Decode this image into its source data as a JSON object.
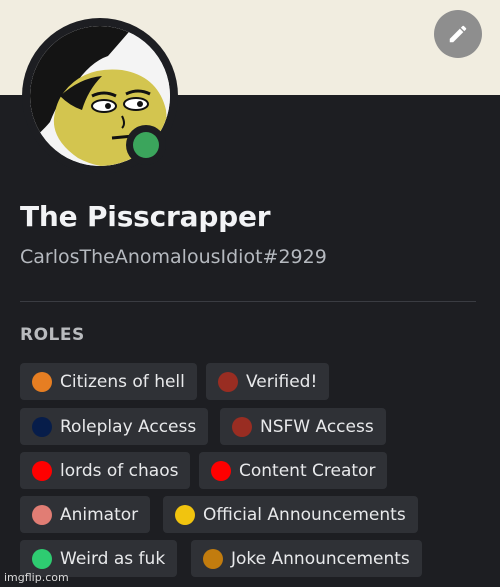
{
  "profile": {
    "display_name": "The Pisscrapper",
    "username_tag": "CarlosTheAnomalousIdiot#2929",
    "status": "online",
    "status_color": "#3ba55c"
  },
  "banner": {
    "color": "#f1ede0"
  },
  "edit_button": {
    "icon": "pencil-icon"
  },
  "roles": {
    "heading": "ROLES",
    "items": [
      {
        "label": "Citizens of hell",
        "color": "#e67e22"
      },
      {
        "label": "Verified!",
        "color": "#992d22"
      },
      {
        "label": "Roleplay Access",
        "color": "#071d4a"
      },
      {
        "label": "NSFW Access",
        "color": "#992d22"
      },
      {
        "label": "lords of chaos",
        "color": "#ff0000"
      },
      {
        "label": "Content Creator",
        "color": "#ff0000"
      },
      {
        "label": "Animator",
        "color": "#e17d74"
      },
      {
        "label": "Official Announcements",
        "color": "#f1c40f"
      },
      {
        "label": "Weird as fuk",
        "color": "#2ecc71"
      },
      {
        "label": "Joke Announcements",
        "color": "#c27c0e"
      }
    ]
  },
  "watermark": "imgflip.com"
}
